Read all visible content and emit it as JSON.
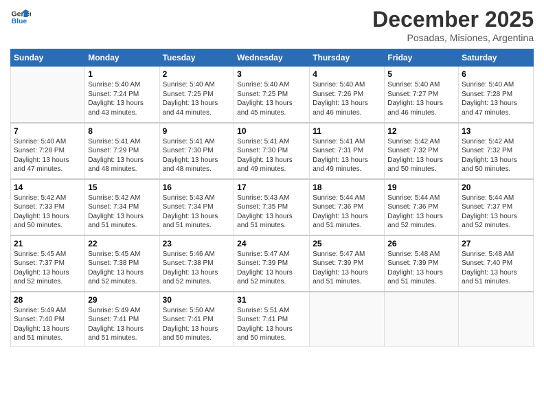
{
  "logo": {
    "line1": "General",
    "line2": "Blue"
  },
  "title": "December 2025",
  "subtitle": "Posadas, Misiones, Argentina",
  "days_of_week": [
    "Sunday",
    "Monday",
    "Tuesday",
    "Wednesday",
    "Thursday",
    "Friday",
    "Saturday"
  ],
  "weeks": [
    [
      {
        "day": "",
        "info": ""
      },
      {
        "day": "1",
        "info": "Sunrise: 5:40 AM\nSunset: 7:24 PM\nDaylight: 13 hours\nand 43 minutes."
      },
      {
        "day": "2",
        "info": "Sunrise: 5:40 AM\nSunset: 7:25 PM\nDaylight: 13 hours\nand 44 minutes."
      },
      {
        "day": "3",
        "info": "Sunrise: 5:40 AM\nSunset: 7:25 PM\nDaylight: 13 hours\nand 45 minutes."
      },
      {
        "day": "4",
        "info": "Sunrise: 5:40 AM\nSunset: 7:26 PM\nDaylight: 13 hours\nand 46 minutes."
      },
      {
        "day": "5",
        "info": "Sunrise: 5:40 AM\nSunset: 7:27 PM\nDaylight: 13 hours\nand 46 minutes."
      },
      {
        "day": "6",
        "info": "Sunrise: 5:40 AM\nSunset: 7:28 PM\nDaylight: 13 hours\nand 47 minutes."
      }
    ],
    [
      {
        "day": "7",
        "info": "Sunrise: 5:40 AM\nSunset: 7:28 PM\nDaylight: 13 hours\nand 47 minutes."
      },
      {
        "day": "8",
        "info": "Sunrise: 5:41 AM\nSunset: 7:29 PM\nDaylight: 13 hours\nand 48 minutes."
      },
      {
        "day": "9",
        "info": "Sunrise: 5:41 AM\nSunset: 7:30 PM\nDaylight: 13 hours\nand 48 minutes."
      },
      {
        "day": "10",
        "info": "Sunrise: 5:41 AM\nSunset: 7:30 PM\nDaylight: 13 hours\nand 49 minutes."
      },
      {
        "day": "11",
        "info": "Sunrise: 5:41 AM\nSunset: 7:31 PM\nDaylight: 13 hours\nand 49 minutes."
      },
      {
        "day": "12",
        "info": "Sunrise: 5:42 AM\nSunset: 7:32 PM\nDaylight: 13 hours\nand 50 minutes."
      },
      {
        "day": "13",
        "info": "Sunrise: 5:42 AM\nSunset: 7:32 PM\nDaylight: 13 hours\nand 50 minutes."
      }
    ],
    [
      {
        "day": "14",
        "info": "Sunrise: 5:42 AM\nSunset: 7:33 PM\nDaylight: 13 hours\nand 50 minutes."
      },
      {
        "day": "15",
        "info": "Sunrise: 5:42 AM\nSunset: 7:34 PM\nDaylight: 13 hours\nand 51 minutes."
      },
      {
        "day": "16",
        "info": "Sunrise: 5:43 AM\nSunset: 7:34 PM\nDaylight: 13 hours\nand 51 minutes."
      },
      {
        "day": "17",
        "info": "Sunrise: 5:43 AM\nSunset: 7:35 PM\nDaylight: 13 hours\nand 51 minutes."
      },
      {
        "day": "18",
        "info": "Sunrise: 5:44 AM\nSunset: 7:36 PM\nDaylight: 13 hours\nand 51 minutes."
      },
      {
        "day": "19",
        "info": "Sunrise: 5:44 AM\nSunset: 7:36 PM\nDaylight: 13 hours\nand 52 minutes."
      },
      {
        "day": "20",
        "info": "Sunrise: 5:44 AM\nSunset: 7:37 PM\nDaylight: 13 hours\nand 52 minutes."
      }
    ],
    [
      {
        "day": "21",
        "info": "Sunrise: 5:45 AM\nSunset: 7:37 PM\nDaylight: 13 hours\nand 52 minutes."
      },
      {
        "day": "22",
        "info": "Sunrise: 5:45 AM\nSunset: 7:38 PM\nDaylight: 13 hours\nand 52 minutes."
      },
      {
        "day": "23",
        "info": "Sunrise: 5:46 AM\nSunset: 7:38 PM\nDaylight: 13 hours\nand 52 minutes."
      },
      {
        "day": "24",
        "info": "Sunrise: 5:47 AM\nSunset: 7:39 PM\nDaylight: 13 hours\nand 52 minutes."
      },
      {
        "day": "25",
        "info": "Sunrise: 5:47 AM\nSunset: 7:39 PM\nDaylight: 13 hours\nand 51 minutes."
      },
      {
        "day": "26",
        "info": "Sunrise: 5:48 AM\nSunset: 7:39 PM\nDaylight: 13 hours\nand 51 minutes."
      },
      {
        "day": "27",
        "info": "Sunrise: 5:48 AM\nSunset: 7:40 PM\nDaylight: 13 hours\nand 51 minutes."
      }
    ],
    [
      {
        "day": "28",
        "info": "Sunrise: 5:49 AM\nSunset: 7:40 PM\nDaylight: 13 hours\nand 51 minutes."
      },
      {
        "day": "29",
        "info": "Sunrise: 5:49 AM\nSunset: 7:41 PM\nDaylight: 13 hours\nand 51 minutes."
      },
      {
        "day": "30",
        "info": "Sunrise: 5:50 AM\nSunset: 7:41 PM\nDaylight: 13 hours\nand 50 minutes."
      },
      {
        "day": "31",
        "info": "Sunrise: 5:51 AM\nSunset: 7:41 PM\nDaylight: 13 hours\nand 50 minutes."
      },
      {
        "day": "",
        "info": ""
      },
      {
        "day": "",
        "info": ""
      },
      {
        "day": "",
        "info": ""
      }
    ]
  ]
}
